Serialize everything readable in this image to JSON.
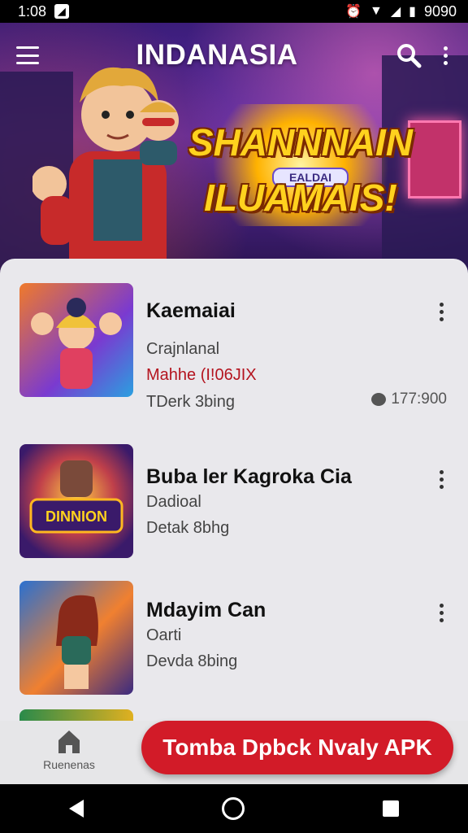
{
  "status_bar": {
    "time": "1:08",
    "battery_text": "9090"
  },
  "header": {
    "title": "INDANASIA"
  },
  "banner": {
    "line1": "SHANNNAIN",
    "line2": "EALDAI",
    "line3": "ILUAMAIS!"
  },
  "items": [
    {
      "title": "Kaemaiai",
      "line1": "Crajnlanal",
      "line2": "Mahhe (I!06JIX",
      "line3": "TDerk 3bing",
      "count": "177:900"
    },
    {
      "title": "Buba ler Kagroka Cia",
      "line1": "Dadioal",
      "line2": "Detak 8bhg",
      "badge": "DINNION"
    },
    {
      "title": "Mdayim Can",
      "line1": "Oarti",
      "line2": "Devda 8bing"
    }
  ],
  "bottom": {
    "home_label": "Ruenenas",
    "cta_label": "Tomba Dpbck Nvaly APK"
  },
  "colors": {
    "accent": "#d21b28",
    "hero": "#4a2390"
  }
}
